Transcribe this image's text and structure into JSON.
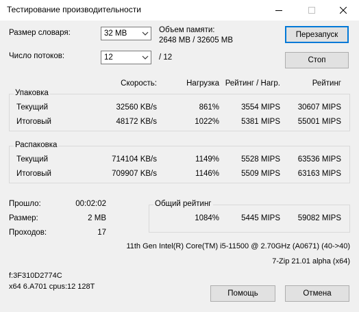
{
  "window": {
    "title": "Тестирование производительности"
  },
  "dictionary": {
    "label": "Размер словаря:",
    "value": "32 MB"
  },
  "threads": {
    "label": "Число потоков:",
    "value": "12",
    "max": "/ 12"
  },
  "memory": {
    "label": "Объем памяти:",
    "value": "2648 MB / 32605 MB"
  },
  "buttons": {
    "restart": "Перезапуск",
    "stop": "Стоп",
    "help": "Помощь",
    "cancel": "Отмена"
  },
  "columns": {
    "speed": "Скорость:",
    "load": "Нагрузка",
    "rating_load": "Рейтинг / Нагр.",
    "rating": "Рейтинг"
  },
  "compress": {
    "title": "Упаковка",
    "rows": [
      {
        "label": "Текущий",
        "speed": "32560 KB/s",
        "load": "861%",
        "rating_load": "3554 MIPS",
        "rating": "30607 MIPS"
      },
      {
        "label": "Итоговый",
        "speed": "48172 KB/s",
        "load": "1022%",
        "rating_load": "5381 MIPS",
        "rating": "55001 MIPS"
      }
    ]
  },
  "decompress": {
    "title": "Распаковка",
    "rows": [
      {
        "label": "Текущий",
        "speed": "714104 KB/s",
        "load": "1149%",
        "rating_load": "5528 MIPS",
        "rating": "63536 MIPS"
      },
      {
        "label": "Итоговый",
        "speed": "709907 KB/s",
        "load": "1146%",
        "rating_load": "5509 MIPS",
        "rating": "63163 MIPS"
      }
    ]
  },
  "stats": {
    "elapsed_label": "Прошло:",
    "elapsed": "00:02:02",
    "size_label": "Размер:",
    "size": "2 MB",
    "passes_label": "Проходов:",
    "passes": "17"
  },
  "overall": {
    "title": "Общий рейтинг",
    "load": "1084%",
    "rating_load": "5445 MIPS",
    "rating": "59082 MIPS"
  },
  "system": {
    "cpu": "11th Gen Intel(R) Core(TM) i5-11500 @ 2.70GHz (A0671) (40->40)",
    "version": "7-Zip 21.01 alpha (x64)",
    "flags": "f:3F310D2774C",
    "arch": "x64 6.A701 cpus:12 128T"
  },
  "icons": {
    "minimize": "minimize-icon",
    "maximize": "maximize-icon",
    "close": "close-icon",
    "dropdown": "chevron-down-icon"
  }
}
